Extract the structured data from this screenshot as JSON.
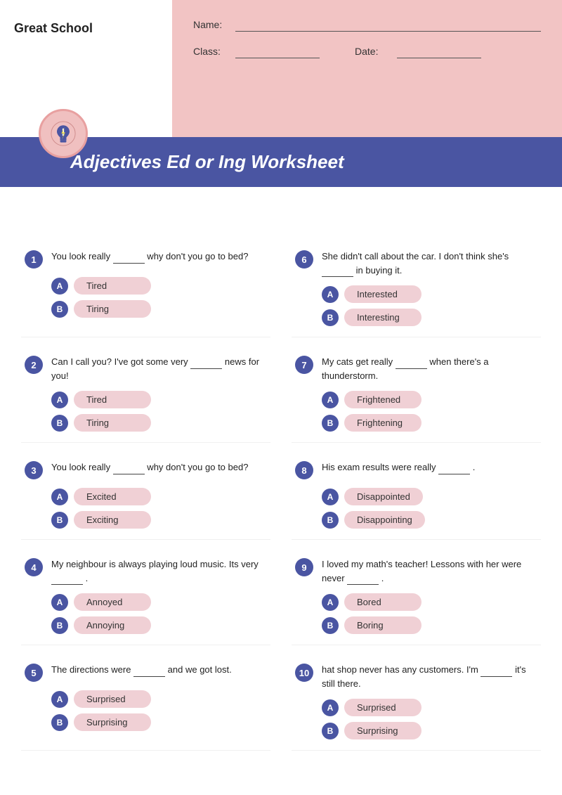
{
  "school": {
    "name": "Great School"
  },
  "header": {
    "name_label": "Name:",
    "class_label": "Class:",
    "date_label": "Date:",
    "title": "Adjectives Ed or Ing Worksheet"
  },
  "questions": [
    {
      "number": "1",
      "text": "You look really",
      "blank": true,
      "text2": "why don't you go to bed?",
      "options": [
        {
          "letter": "A",
          "text": "Tired"
        },
        {
          "letter": "B",
          "text": "Tiring"
        }
      ]
    },
    {
      "number": "6",
      "text": "She didn't call about the car. I don't think she's",
      "blank": true,
      "text2": "in buying it.",
      "options": [
        {
          "letter": "A",
          "text": "Interested"
        },
        {
          "letter": "B",
          "text": "Interesting"
        }
      ]
    },
    {
      "number": "2",
      "text": "Can I call you? I've got some very",
      "blank": true,
      "text2": "news for you!",
      "options": [
        {
          "letter": "A",
          "text": "Tired"
        },
        {
          "letter": "B",
          "text": "Tiring"
        }
      ]
    },
    {
      "number": "7",
      "text": "My cats get really",
      "blank": true,
      "text2": "when there's a thunderstorm.",
      "options": [
        {
          "letter": "A",
          "text": "Frightened"
        },
        {
          "letter": "B",
          "text": "Frightening"
        }
      ]
    },
    {
      "number": "3",
      "text": "You look really",
      "blank": true,
      "text2": "why don't you go to bed?",
      "options": [
        {
          "letter": "A",
          "text": "Excited"
        },
        {
          "letter": "B",
          "text": "Exciting"
        }
      ]
    },
    {
      "number": "8",
      "text": "His exam results were really",
      "blank": true,
      "text2": ".",
      "options": [
        {
          "letter": "A",
          "text": "Disappointed"
        },
        {
          "letter": "B",
          "text": "Disappointing"
        }
      ]
    },
    {
      "number": "4",
      "text": "My neighbour is always playing loud music. Its very",
      "blank": true,
      "text2": ".",
      "options": [
        {
          "letter": "A",
          "text": "Annoyed"
        },
        {
          "letter": "B",
          "text": "Annoying"
        }
      ]
    },
    {
      "number": "9",
      "text": "I loved my math's teacher! Lessons with her were never",
      "blank": true,
      "text2": ".",
      "options": [
        {
          "letter": "A",
          "text": "Bored"
        },
        {
          "letter": "B",
          "text": "Boring"
        }
      ]
    },
    {
      "number": "5",
      "text": "The directions were",
      "blank": true,
      "text2": "and we got lost.",
      "options": [
        {
          "letter": "A",
          "text": "Surprised"
        },
        {
          "letter": "B",
          "text": "Surprising"
        }
      ]
    },
    {
      "number": "10",
      "text": "hat shop never has any customers. I'm",
      "blank": true,
      "text2": "it's still there.",
      "options": [
        {
          "letter": "A",
          "text": "Surprised"
        },
        {
          "letter": "B",
          "text": "Surprising"
        }
      ]
    }
  ]
}
